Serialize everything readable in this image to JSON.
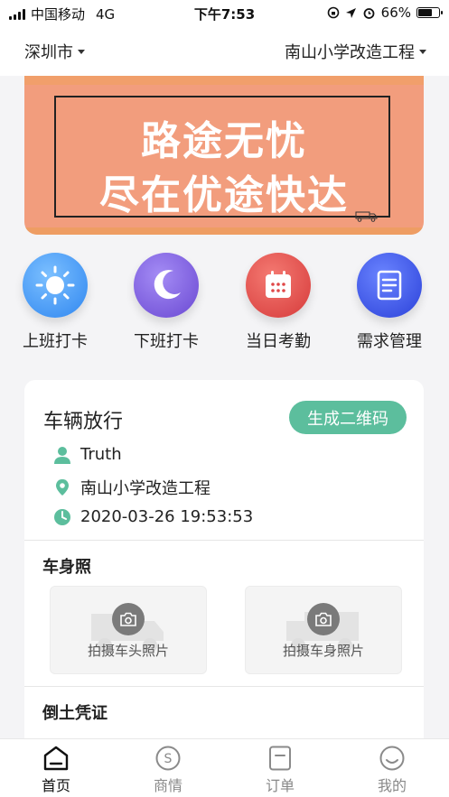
{
  "status_bar": {
    "carrier": "中国移动",
    "network": "4G",
    "time": "下午7:53",
    "battery": "66%",
    "battery_level": 0.66
  },
  "header": {
    "city": "深圳市",
    "project": "南山小学改造工程"
  },
  "banner": {
    "line1": "路途无忧",
    "line2": "尽在优途快达"
  },
  "quick_actions": [
    {
      "label": "上班打卡",
      "icon": "sun-icon",
      "color": "#3d93f5"
    },
    {
      "label": "下班打卡",
      "icon": "moon-icon",
      "color": "#7b5cdc"
    },
    {
      "label": "当日考勤",
      "icon": "calendar-icon",
      "color": "#e64a4a"
    },
    {
      "label": "需求管理",
      "icon": "document-icon",
      "color": "#3c52e4"
    }
  ],
  "card": {
    "title": "车辆放行",
    "qr_button": "生成二维码",
    "user": "Truth",
    "location": "南山小学改造工程",
    "datetime": "2020-03-26  19:53:53",
    "section_car_photos": "车身照",
    "photo_front_label": "拍摄车头照片",
    "photo_body_label": "拍摄车身照片",
    "section_dump": "倒土凭证"
  },
  "tabbar": [
    {
      "label": "首页",
      "icon": "home-icon",
      "active": true
    },
    {
      "label": "商情",
      "icon": "dollar-coin-icon",
      "active": false
    },
    {
      "label": "订单",
      "icon": "order-icon",
      "active": false
    },
    {
      "label": "我的",
      "icon": "smiley-icon",
      "active": false
    }
  ],
  "colors": {
    "accent_green": "#5cbe9d",
    "banner_bg": "#f29d7d"
  }
}
